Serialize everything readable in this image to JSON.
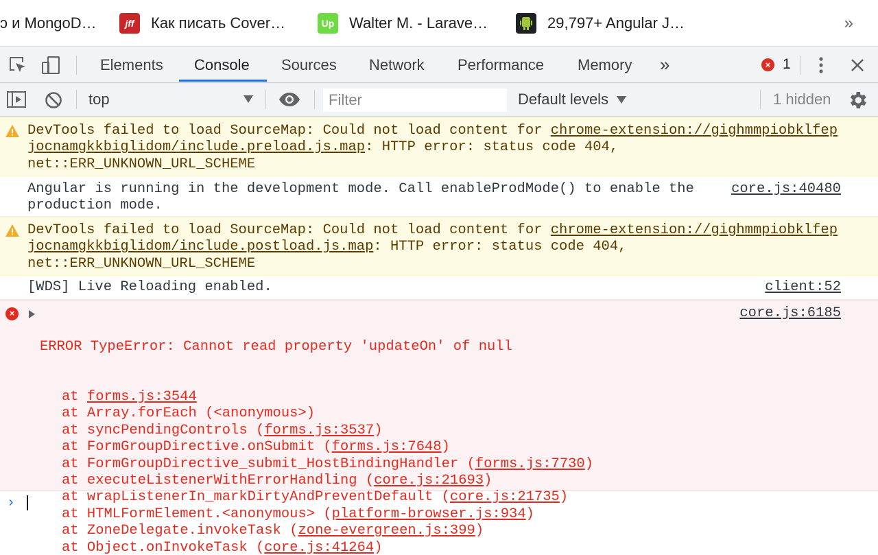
{
  "bookmarks": [
    {
      "label": "ↄ и MongoD…",
      "icon": "none"
    },
    {
      "label": "Как писать Cover…",
      "icon": "jff-icon",
      "icon_text": "jff"
    },
    {
      "label": "Walter M. - Larave…",
      "icon": "upwork-icon",
      "icon_text": "Up"
    },
    {
      "label": "29,797+ Angular J…",
      "icon": "android-icon"
    }
  ],
  "bookmarks_more": "»",
  "devtools": {
    "tabs": [
      "Elements",
      "Console",
      "Sources",
      "Network",
      "Performance",
      "Memory"
    ],
    "active_tab": "Console",
    "more_tabs": "»",
    "error_count": "1",
    "error_badge": "×"
  },
  "toolbar": {
    "context": "top",
    "filter_placeholder": "Filter",
    "levels": "Default levels",
    "hidden": "1 hidden"
  },
  "colors": {
    "warning_bg": "#fefbe5",
    "error_bg": "#fdf2f3",
    "error_text": "#e22b1f",
    "accent": "#1a73e8"
  },
  "messages": {
    "warn1": {
      "prefix": "DevTools failed to load SourceMap: Could not load content for ",
      "link_a": "chrome-extension://gighmmpiobklfep",
      "link_b": "jocnamgkkbiglidom/include.preload.js.map",
      "suffix": ": HTTP error: status code 404,",
      "line3": "net::ERR_UNKNOWN_URL_SCHEME"
    },
    "info1": {
      "line1": "Angular is running in the development mode. Call enableProdMode() to enable the",
      "line2": "production mode.",
      "source": "core.js:40480"
    },
    "warn2": {
      "prefix": "DevTools failed to load SourceMap: Could not load content for ",
      "link_a": "chrome-extension://gighmmpiobklfep",
      "link_b": "jocnamgkkbiglidom/include.postload.js.map",
      "suffix": ": HTTP error: status code 404,",
      "line3": "net::ERR_UNKNOWN_URL_SCHEME"
    },
    "info2": {
      "text": "[WDS] Live Reloading enabled.",
      "source": "client:52"
    },
    "error": {
      "head": "ERROR TypeError: Cannot read property 'updateOn' of null",
      "source": "core.js:6185",
      "stack": [
        {
          "fn": "at ",
          "loc": "forms.js:3544",
          "paren": false
        },
        {
          "fn": "at Array.forEach (<anonymous>)",
          "loc": "",
          "paren": false
        },
        {
          "fn": "at syncPendingControls (",
          "loc": "forms.js:3537",
          "paren": true
        },
        {
          "fn": "at FormGroupDirective.onSubmit (",
          "loc": "forms.js:7648",
          "paren": true
        },
        {
          "fn": "at FormGroupDirective_submit_HostBindingHandler (",
          "loc": "forms.js:7730",
          "paren": true
        },
        {
          "fn": "at executeListenerWithErrorHandling (",
          "loc": "core.js:21693",
          "paren": true
        },
        {
          "fn": "at wrapListenerIn_markDirtyAndPreventDefault (",
          "loc": "core.js:21735",
          "paren": true
        },
        {
          "fn": "at HTMLFormElement.<anonymous> (",
          "loc": "platform-browser.js:934",
          "paren": true
        },
        {
          "fn": "at ZoneDelegate.invokeTask (",
          "loc": "zone-evergreen.js:399",
          "paren": true
        },
        {
          "fn": "at Object.onInvokeTask (",
          "loc": "core.js:41264",
          "paren": true
        }
      ]
    }
  },
  "prompt_symbol": "›"
}
